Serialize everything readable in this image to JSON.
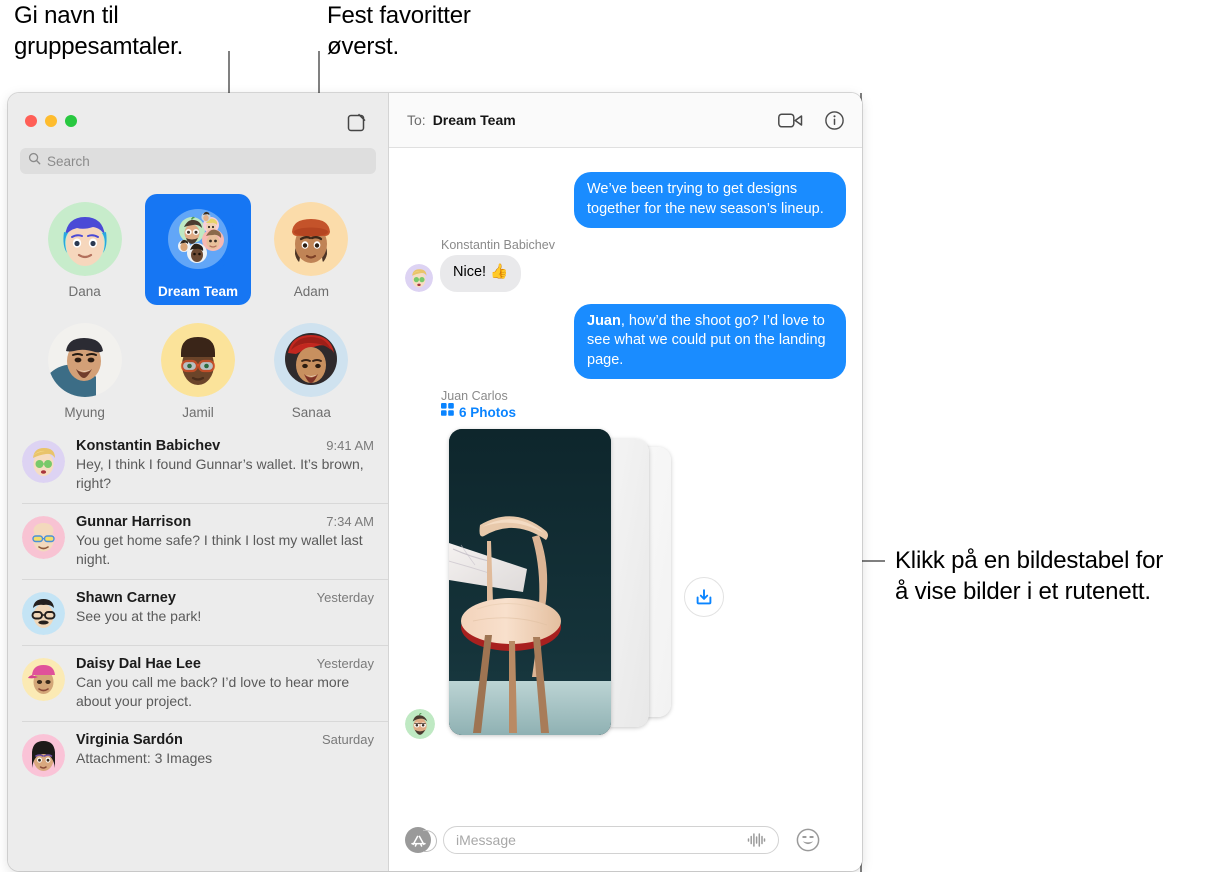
{
  "callouts": [
    {
      "id": "name-groups",
      "text": "Gi navn til\ngruppesamtaler."
    },
    {
      "id": "pin-favorites",
      "text": "Fest favoritter\nøverst."
    },
    {
      "id": "photo-stack",
      "text": "Klikk på en bildestabel for\nå vise bilder i et rutenett."
    }
  ],
  "window": {
    "traffic_lights": [
      "close",
      "minimize",
      "zoom"
    ],
    "compose_icon": "compose-icon"
  },
  "sidebar": {
    "search": {
      "placeholder": "Search",
      "value": "",
      "icon": "search-icon"
    },
    "pinned": [
      {
        "name": "Dana",
        "selected": false,
        "avatar": "memoji-dana"
      },
      {
        "name": "Dream Team",
        "selected": true,
        "avatar": "group-dream-team"
      },
      {
        "name": "Adam",
        "selected": false,
        "avatar": "memoji-adam"
      },
      {
        "name": "Myung",
        "selected": false,
        "avatar": "photo-myung"
      },
      {
        "name": "Jamil",
        "selected": false,
        "avatar": "memoji-jamil"
      },
      {
        "name": "Sanaa",
        "selected": false,
        "avatar": "photo-sanaa"
      }
    ],
    "conversations": [
      {
        "name": "Konstantin Babichev",
        "time": "9:41 AM",
        "preview": "Hey, I think I found Gunnar’s wallet. It’s brown, right?"
      },
      {
        "name": "Gunnar Harrison",
        "time": "7:34 AM",
        "preview": "You get home safe? I think I lost my wallet last night."
      },
      {
        "name": "Shawn Carney",
        "time": "Yesterday",
        "preview": "See you at the park!"
      },
      {
        "name": "Daisy Dal Hae Lee",
        "time": "Yesterday",
        "preview": "Can you call me back? I’d love to hear more about your project."
      },
      {
        "name": "Virginia Sardón",
        "time": "Saturday",
        "preview": "Attachment: 3 Images"
      }
    ]
  },
  "thread": {
    "to_label": "To:",
    "to_value": "Dream Team",
    "facetime_icon": "video-camera-icon",
    "info_icon": "info-circle-icon",
    "messages": [
      {
        "direction": "out",
        "text": "We’ve been trying to get designs together for the new season’s lineup."
      },
      {
        "direction": "in",
        "sender": "Konstantin Babichev",
        "text": "Nice! 👍"
      },
      {
        "direction": "out",
        "mention": "Juan",
        "text": ", how’d the shoot go? I’d love to see what we could put on the landing page."
      },
      {
        "direction": "in",
        "sender": "Juan Carlos",
        "attachment": {
          "count_label": "6 Photos",
          "grid_icon": "photo-grid-icon",
          "download_icon": "download-icon"
        }
      }
    ]
  },
  "composer": {
    "apps_icon": "app-store-icon",
    "input": {
      "placeholder": "iMessage",
      "value": ""
    },
    "audio_icon": "audio-waveform-icon",
    "emoji_icon": "smiley-face-icon"
  },
  "colors": {
    "accent_blue": "#1a8cff",
    "link_blue": "#0a84ff",
    "pinned_selected": "#1676f3",
    "bubble_in": "#e9e9eb",
    "sidebar_bg": "#ececec"
  }
}
